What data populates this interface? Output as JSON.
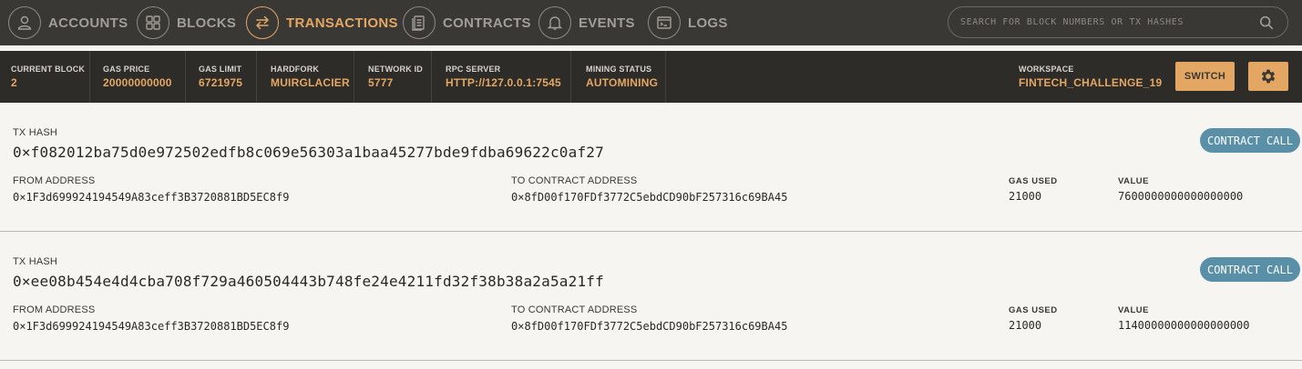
{
  "nav": {
    "items": [
      {
        "label": "ACCOUNTS",
        "icon": "user-icon"
      },
      {
        "label": "BLOCKS",
        "icon": "grid-icon"
      },
      {
        "label": "TRANSACTIONS",
        "icon": "swap-arrows-icon"
      },
      {
        "label": "CONTRACTS",
        "icon": "document-icon"
      },
      {
        "label": "EVENTS",
        "icon": "bell-icon"
      },
      {
        "label": "LOGS",
        "icon": "terminal-icon"
      }
    ],
    "active": "TRANSACTIONS",
    "search_placeholder": "SEARCH FOR BLOCK NUMBERS OR TX HASHES"
  },
  "status": {
    "current_block": {
      "label": "CURRENT BLOCK",
      "value": "2"
    },
    "gas_price": {
      "label": "GAS PRICE",
      "value": "20000000000"
    },
    "gas_limit": {
      "label": "GAS LIMIT",
      "value": "6721975"
    },
    "hardfork": {
      "label": "HARDFORK",
      "value": "MUIRGLACIER"
    },
    "network_id": {
      "label": "NETWORK ID",
      "value": "5777"
    },
    "rpc_server": {
      "label": "RPC SERVER",
      "value": "HTTP://127.0.0.1:7545"
    },
    "mining_status": {
      "label": "MINING STATUS",
      "value": "AUTOMINING"
    },
    "workspace": {
      "label": "WORKSPACE",
      "value": "FINTECH_CHALLENGE_19"
    },
    "switch_label": "SWITCH"
  },
  "transactions": [
    {
      "tx_hash_label": "TX HASH",
      "tx_hash": "0×f082012ba75d0e972502edfb8c069e56303a1baa45277bde9fdba69622c0af27",
      "type": "CONTRACT CALL",
      "from_label": "FROM ADDRESS",
      "from": "0×1F3d699924194549A83ceff3B3720881BD5EC8f9",
      "to_label": "TO CONTRACT ADDRESS",
      "to": "0×8fD00f170FDf3772C5ebdCD90bF257316c69BA45",
      "gas_used_label": "GAS USED",
      "gas_used": "21000",
      "value_label": "VALUE",
      "value": "7600000000000000000"
    },
    {
      "tx_hash_label": "TX HASH",
      "tx_hash": "0×ee08b454e4d4cba708f729a460504443b748fe24e4211fd32f38b38a2a5a21ff",
      "type": "CONTRACT CALL",
      "from_label": "FROM ADDRESS",
      "from": "0×1F3d699924194549A83ceff3B3720881BD5EC8f9",
      "to_label": "TO CONTRACT ADDRESS",
      "to": "0×8fD00f170FDf3772C5ebdCD90bF257316c69BA45",
      "gas_used_label": "GAS USED",
      "gas_used": "21000",
      "value_label": "VALUE",
      "value": "11400000000000000000"
    }
  ],
  "colors": {
    "accent": "#e4a663",
    "nav_bg": "#3a3835",
    "status_bg": "#2e2c29",
    "badge": "#5a8fa8",
    "page_bg": "#f6f5f1"
  }
}
